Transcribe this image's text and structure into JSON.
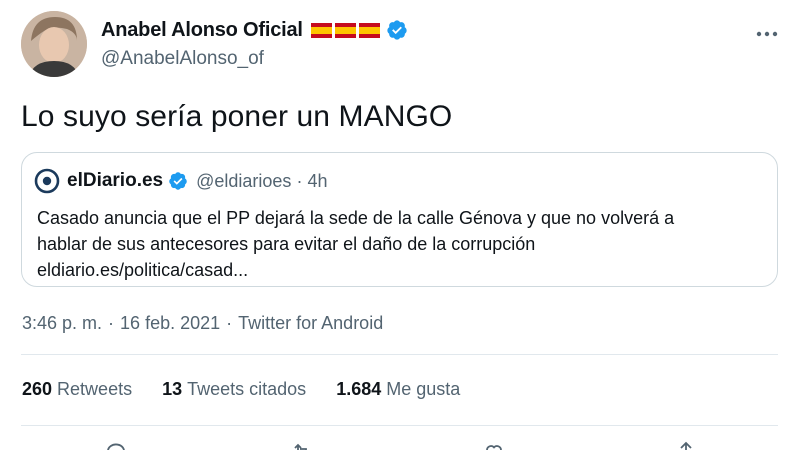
{
  "author": {
    "display_name": "Anabel Alonso Oficial",
    "handle": "@AnabelAlonso_of",
    "flags": [
      "spain-flag",
      "spain-flag",
      "spain-flag"
    ],
    "verified": true
  },
  "tweet": {
    "text": "Lo suyo sería poner un MANGO"
  },
  "quoted_tweet": {
    "name": "elDiario.es",
    "handle": "@eldiarioes",
    "separator": "·",
    "time": "4h",
    "lines": [
      "Casado anuncia que el PP dejará la sede de la calle Génova y que no volverá a",
      "hablar de sus antecesores para evitar el daño de la corrupción",
      "eldiario.es/politica/casad..."
    ]
  },
  "meta": {
    "time": "3:46 p. m.",
    "separator": "·",
    "date": "16 feb. 2021",
    "source": "Twitter for Android"
  },
  "stats": {
    "retweets_count": "260",
    "retweets_label": "Retweets",
    "quotes_count": "13",
    "quotes_label": "Tweets citados",
    "likes_count": "1.684",
    "likes_label": "Me gusta"
  },
  "icons": {
    "more": "more-dots-icon",
    "reply": "reply-icon",
    "retweet": "retweet-icon",
    "like": "heart-icon",
    "share": "share-icon"
  },
  "colors": {
    "verified_blue": "#1d9bf0",
    "text_primary": "#0f1419",
    "text_secondary": "#536471",
    "border": "#cfd9de",
    "flag_red": "#c60b1e",
    "flag_yellow": "#ffc400"
  }
}
